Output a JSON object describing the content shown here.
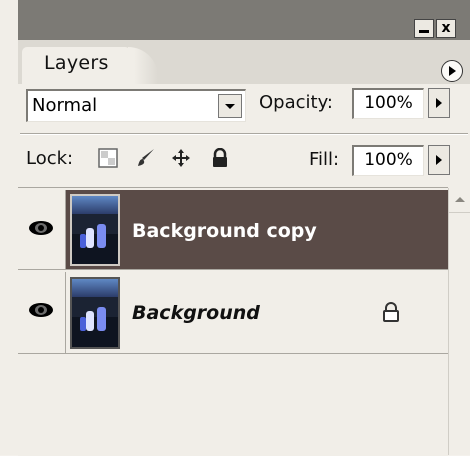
{
  "panel": {
    "tab_label": "Layers",
    "blend_mode": "Normal",
    "opacity_label": "Opacity:",
    "opacity_value": "100%",
    "lock_label": "Lock:",
    "fill_label": "Fill:",
    "fill_value": "100%"
  },
  "window_controls": {
    "minimize_icon": "minimize-icon",
    "close_glyph": "x"
  },
  "layers": [
    {
      "name": "Background copy",
      "visible": true,
      "selected": true,
      "locked": false
    },
    {
      "name": "Background",
      "visible": true,
      "selected": false,
      "locked": true
    }
  ],
  "colors": {
    "selected_row": "#5a4b47",
    "panel_bg": "#f1eee8",
    "title_bg": "#7c7a75"
  },
  "icons": [
    "eye-icon",
    "lock-transparent-icon",
    "brush-icon",
    "move-icon",
    "lock-icon",
    "panel-menu-icon"
  ]
}
